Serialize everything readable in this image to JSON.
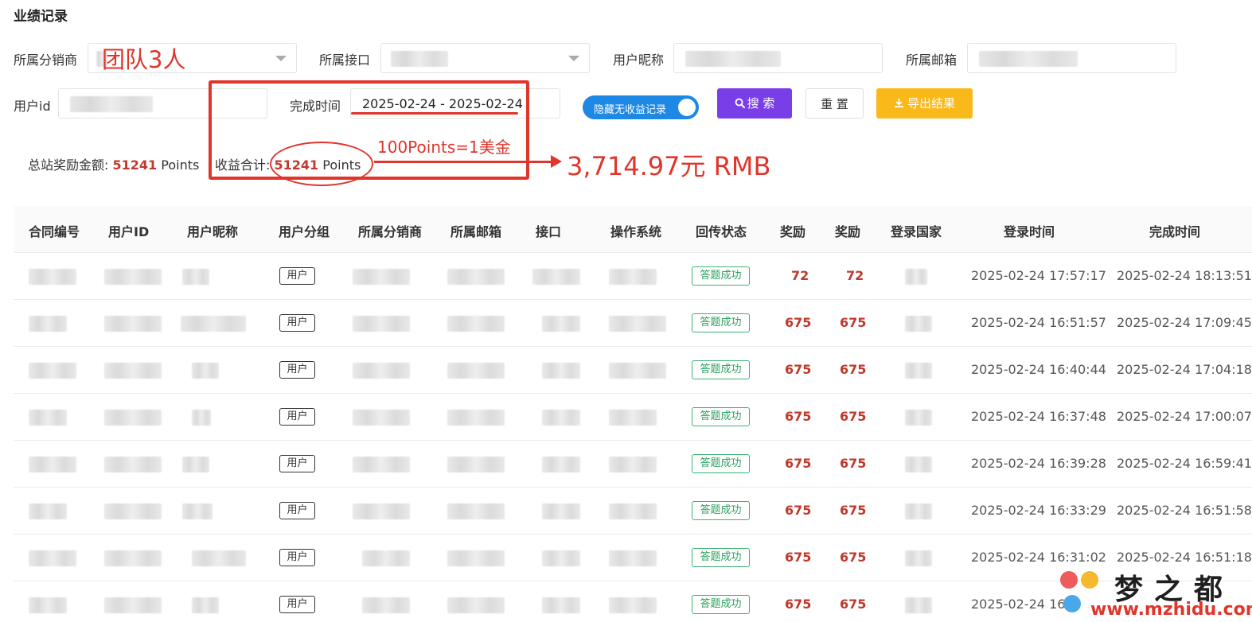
{
  "page": {
    "title": "业绩记录"
  },
  "filters": {
    "distributor_label": "所属分销商",
    "distributor_value": "团队3人",
    "interface_label": "所属接口",
    "nickname_label": "用户昵称",
    "email_label": "所属邮箱",
    "userid_label": "用户id",
    "finish_time_label": "完成时间",
    "finish_time_value": "2025-02-24 - 2025-02-24",
    "hide_toggle_label": "隐藏无收益记录",
    "search_label": "搜 索",
    "reset_label": "重 置",
    "export_label": "导出结果"
  },
  "summary": {
    "total_label": "总站奖励金额:",
    "total_value": "51241",
    "total_unit": "Points",
    "income_label": "收益合计:",
    "income_value": "51241",
    "income_unit": "Points"
  },
  "annotations": {
    "rate": "100Points=1美金",
    "rmb": "3,714.97元 RMB"
  },
  "table": {
    "columns": [
      "合同编号",
      "用户ID",
      "用户昵称",
      "用户分组",
      "所属分销商",
      "所属邮箱",
      "接口",
      "操作系统",
      "回传状态",
      "奖励",
      "奖励",
      "登录国家",
      "登录时间",
      "完成时间"
    ],
    "rows": [
      {
        "group": "用户",
        "status": "答题成功",
        "reward1": "72",
        "reward2": "72",
        "login_time": "2025-02-24 17:57:17",
        "finish_time": "2025-02-24 18:13:51"
      },
      {
        "group": "用户",
        "status": "答题成功",
        "reward1": "675",
        "reward2": "675",
        "login_time": "2025-02-24 16:51:57",
        "finish_time": "2025-02-24 17:09:45"
      },
      {
        "group": "用户",
        "status": "答题成功",
        "reward1": "675",
        "reward2": "675",
        "login_time": "2025-02-24 16:40:44",
        "finish_time": "2025-02-24 17:04:18"
      },
      {
        "group": "用户",
        "status": "答题成功",
        "reward1": "675",
        "reward2": "675",
        "login_time": "2025-02-24 16:37:48",
        "finish_time": "2025-02-24 17:00:07"
      },
      {
        "group": "用户",
        "status": "答题成功",
        "reward1": "675",
        "reward2": "675",
        "login_time": "2025-02-24 16:39:28",
        "finish_time": "2025-02-24 16:59:41"
      },
      {
        "group": "用户",
        "status": "答题成功",
        "reward1": "675",
        "reward2": "675",
        "login_time": "2025-02-24 16:33:29",
        "finish_time": "2025-02-24 16:51:58"
      },
      {
        "group": "用户",
        "status": "答题成功",
        "reward1": "675",
        "reward2": "675",
        "login_time": "2025-02-24 16:31:02",
        "finish_time": "2025-02-24 16:51:18"
      },
      {
        "group": "用户",
        "status": "答题成功",
        "reward1": "675",
        "reward2": "675",
        "login_time": "2025-02-24 16:3",
        "finish_time": ""
      }
    ]
  },
  "watermark": {
    "title": "梦之都",
    "url": "www.mzhidu.com"
  },
  "colors": {
    "accent_red": "#e0352b",
    "search_purple": "#7a3ee8",
    "export_yellow": "#f9b91a",
    "toggle_blue": "#1e88e5",
    "status_green": "#3cb371"
  },
  "icons": {
    "dropdown": "chevron-down-icon",
    "search": "search-icon",
    "export": "download-icon"
  }
}
